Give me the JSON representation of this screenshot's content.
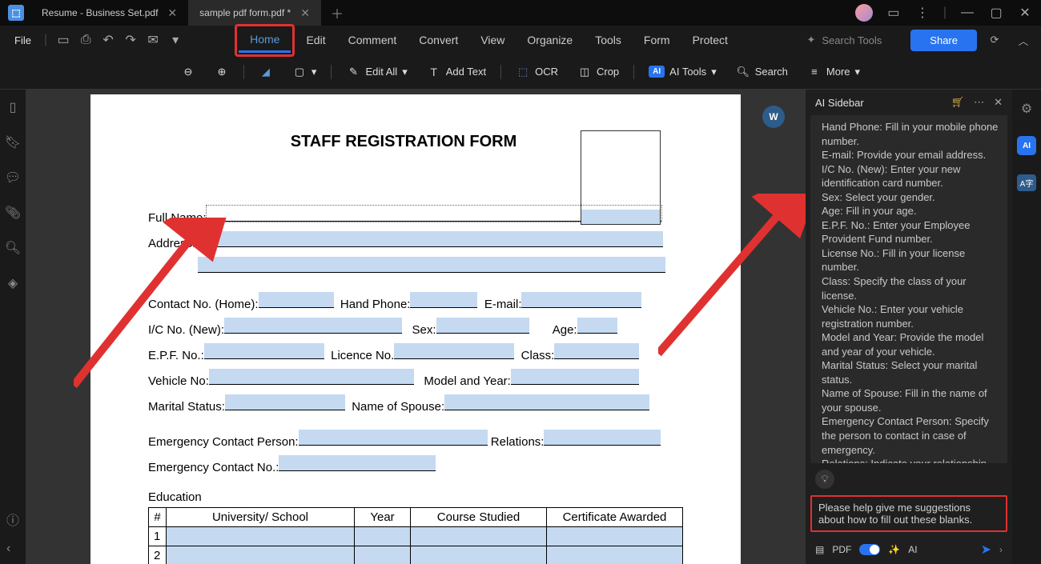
{
  "tabs": [
    {
      "label": "Resume - Business Set.pdf",
      "active": false
    },
    {
      "label": "sample pdf form.pdf *",
      "active": true
    }
  ],
  "file_menu": "File",
  "menus": [
    "Home",
    "Edit",
    "Comment",
    "Convert",
    "View",
    "Organize",
    "Tools",
    "Form",
    "Protect"
  ],
  "search_tools": "Search Tools",
  "share": "Share",
  "toolbar": {
    "edit_all": "Edit All",
    "add_text": "Add Text",
    "ocr": "OCR",
    "crop": "Crop",
    "ai_tools": "AI Tools",
    "search": "Search",
    "more": "More"
  },
  "form": {
    "title": "STAFF REGISTRATION FORM",
    "full_name": "Full Name:",
    "address": "Address:",
    "contact_home": "Contact No. (Home):",
    "hand_phone": "Hand Phone:",
    "email": "E-mail:",
    "ic_no": "I/C No. (New):",
    "sex": "Sex:",
    "age": "Age:",
    "epf": "E.P.F. No.:",
    "licence": "Licence No.",
    "class": "Class:",
    "vehicle": "Vehicle No:",
    "model_year": "Model and Year:",
    "marital": "Marital Status:",
    "spouse": "Name of Spouse:",
    "emergency_person": "Emergency Contact Person:",
    "relations": "Relations:",
    "emergency_no": "Emergency Contact No.:",
    "education": "Education",
    "thead": {
      "num": "#",
      "uni": "University/ School",
      "year": "Year",
      "course": "Course Studied",
      "cert": "Certificate Awarded"
    },
    "rows": [
      "1",
      "2"
    ]
  },
  "ai": {
    "title": "AI Sidebar",
    "content": "Hand Phone: Fill in your mobile phone number.\nE-mail: Provide your email address.\nI/C No. (New): Enter your new identification card number.\nSex: Select your gender.\nAge: Fill in your age.\nE.P.F. No.: Enter your Employee Provident Fund number.\nLicense No.: Fill in your license number.\nClass: Specify the class of your license.\nVehicle No.: Enter your vehicle registration number.\nModel and Year: Provide the model and year of your vehicle.\nMarital Status: Select your marital status.\nName of Spouse: Fill in the name of your spouse.\nEmergency Contact Person: Specify the person to contact in case of emergency.\nRelations: Indicate your relationship with the emergency contact person.\nEmergency Contact No.: Fill in the phone number of the emergency contact",
    "input": "Please help give me suggestions about how to fill out these blanks.",
    "pdf_label": "PDF",
    "ai_label": "AI"
  }
}
